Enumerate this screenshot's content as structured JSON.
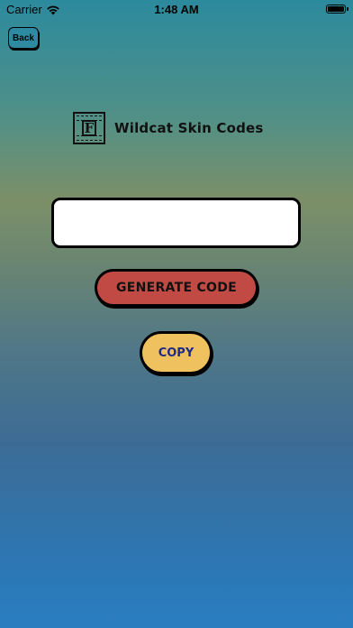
{
  "status_bar": {
    "carrier": "Carrier",
    "time": "1:48 AM",
    "wifi_icon": "wifi-icon",
    "battery_icon": "battery-icon"
  },
  "nav": {
    "back_label": "Back"
  },
  "header": {
    "logo_icon": "fortnite-f-logo-icon",
    "logo_letter": "F",
    "title": "Wildcat Skin Codes"
  },
  "code_field": {
    "value": "",
    "placeholder": ""
  },
  "actions": {
    "generate_label": "GENERATE CODE",
    "copy_label": "COPY"
  },
  "colors": {
    "generate_button": "#c24a44",
    "copy_button": "#f0c25f",
    "copy_text": "#1e2a8a",
    "back_button": "#2e8aa1"
  }
}
